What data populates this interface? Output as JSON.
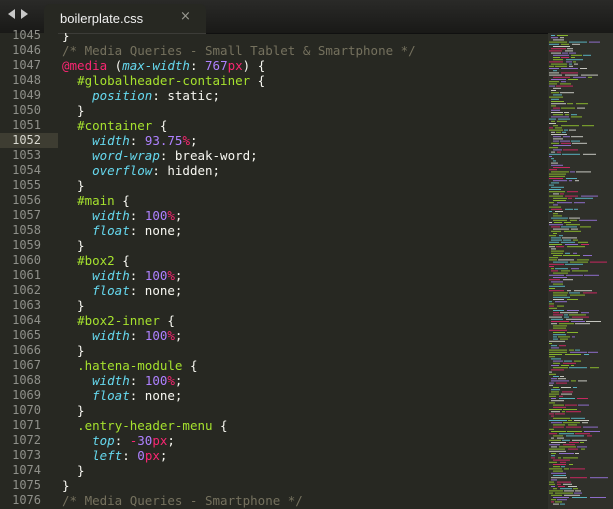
{
  "nav": {
    "back_icon": "chevron-left-icon",
    "forward_icon": "chevron-right-icon"
  },
  "tab": {
    "title": "boilerplate.css",
    "close_glyph": "×"
  },
  "editor": {
    "first_line_partial": "1045",
    "active_line": "1052",
    "lines": [
      {
        "num": "1045",
        "tokens": [
          {
            "t": "}",
            "c": "punct"
          }
        ]
      },
      {
        "num": "1046",
        "tokens": [
          {
            "t": "/* Media Queries - Small Tablet & Smartphone */",
            "c": "comment"
          }
        ]
      },
      {
        "num": "1047",
        "tokens": [
          {
            "t": "@media",
            "c": "at"
          },
          {
            "t": " (",
            "c": "punct"
          },
          {
            "t": "max-width",
            "c": "prop"
          },
          {
            "t": ": ",
            "c": "punct"
          },
          {
            "t": "767",
            "c": "number"
          },
          {
            "t": "px",
            "c": "unit"
          },
          {
            "t": ") {",
            "c": "punct"
          }
        ]
      },
      {
        "num": "1048",
        "tokens": [
          {
            "t": "  ",
            "c": "punct"
          },
          {
            "t": "#globalheader-container",
            "c": "selector"
          },
          {
            "t": " {",
            "c": "punct"
          }
        ]
      },
      {
        "num": "1049",
        "tokens": [
          {
            "t": "    ",
            "c": "punct"
          },
          {
            "t": "position",
            "c": "prop"
          },
          {
            "t": ": static;",
            "c": "value"
          }
        ]
      },
      {
        "num": "1050",
        "tokens": [
          {
            "t": "  }",
            "c": "punct"
          }
        ]
      },
      {
        "num": "1051",
        "tokens": [
          {
            "t": "  ",
            "c": "punct"
          },
          {
            "t": "#container",
            "c": "selector"
          },
          {
            "t": " {",
            "c": "punct"
          }
        ]
      },
      {
        "num": "1052",
        "tokens": [
          {
            "t": "    ",
            "c": "punct"
          },
          {
            "t": "width",
            "c": "prop"
          },
          {
            "t": ": ",
            "c": "punct"
          },
          {
            "t": "93.75",
            "c": "number"
          },
          {
            "t": "%",
            "c": "unit"
          },
          {
            "t": ";",
            "c": "punct"
          }
        ]
      },
      {
        "num": "1053",
        "tokens": [
          {
            "t": "    ",
            "c": "punct"
          },
          {
            "t": "word-wrap",
            "c": "prop"
          },
          {
            "t": ": break-word;",
            "c": "value"
          }
        ]
      },
      {
        "num": "1054",
        "tokens": [
          {
            "t": "    ",
            "c": "punct"
          },
          {
            "t": "overflow",
            "c": "prop"
          },
          {
            "t": ": hidden;",
            "c": "value"
          }
        ]
      },
      {
        "num": "1055",
        "tokens": [
          {
            "t": "  }",
            "c": "punct"
          }
        ]
      },
      {
        "num": "1056",
        "tokens": [
          {
            "t": "  ",
            "c": "punct"
          },
          {
            "t": "#main",
            "c": "selector"
          },
          {
            "t": " {",
            "c": "punct"
          }
        ]
      },
      {
        "num": "1057",
        "tokens": [
          {
            "t": "    ",
            "c": "punct"
          },
          {
            "t": "width",
            "c": "prop"
          },
          {
            "t": ": ",
            "c": "punct"
          },
          {
            "t": "100",
            "c": "number"
          },
          {
            "t": "%",
            "c": "unit"
          },
          {
            "t": ";",
            "c": "punct"
          }
        ]
      },
      {
        "num": "1058",
        "tokens": [
          {
            "t": "    ",
            "c": "punct"
          },
          {
            "t": "float",
            "c": "prop"
          },
          {
            "t": ": none;",
            "c": "value"
          }
        ]
      },
      {
        "num": "1059",
        "tokens": [
          {
            "t": "  }",
            "c": "punct"
          }
        ]
      },
      {
        "num": "1060",
        "tokens": [
          {
            "t": "  ",
            "c": "punct"
          },
          {
            "t": "#box2",
            "c": "selector"
          },
          {
            "t": " {",
            "c": "punct"
          }
        ]
      },
      {
        "num": "1061",
        "tokens": [
          {
            "t": "    ",
            "c": "punct"
          },
          {
            "t": "width",
            "c": "prop"
          },
          {
            "t": ": ",
            "c": "punct"
          },
          {
            "t": "100",
            "c": "number"
          },
          {
            "t": "%",
            "c": "unit"
          },
          {
            "t": ";",
            "c": "punct"
          }
        ]
      },
      {
        "num": "1062",
        "tokens": [
          {
            "t": "    ",
            "c": "punct"
          },
          {
            "t": "float",
            "c": "prop"
          },
          {
            "t": ": none;",
            "c": "value"
          }
        ]
      },
      {
        "num": "1063",
        "tokens": [
          {
            "t": "  }",
            "c": "punct"
          }
        ]
      },
      {
        "num": "1064",
        "tokens": [
          {
            "t": "  ",
            "c": "punct"
          },
          {
            "t": "#box2-inner",
            "c": "selector"
          },
          {
            "t": " {",
            "c": "punct"
          }
        ]
      },
      {
        "num": "1065",
        "tokens": [
          {
            "t": "    ",
            "c": "punct"
          },
          {
            "t": "width",
            "c": "prop"
          },
          {
            "t": ": ",
            "c": "punct"
          },
          {
            "t": "100",
            "c": "number"
          },
          {
            "t": "%",
            "c": "unit"
          },
          {
            "t": ";",
            "c": "punct"
          }
        ]
      },
      {
        "num": "1066",
        "tokens": [
          {
            "t": "  }",
            "c": "punct"
          }
        ]
      },
      {
        "num": "1067",
        "tokens": [
          {
            "t": "  ",
            "c": "punct"
          },
          {
            "t": ".hatena-module",
            "c": "selector"
          },
          {
            "t": " {",
            "c": "punct"
          }
        ]
      },
      {
        "num": "1068",
        "tokens": [
          {
            "t": "    ",
            "c": "punct"
          },
          {
            "t": "width",
            "c": "prop"
          },
          {
            "t": ": ",
            "c": "punct"
          },
          {
            "t": "100",
            "c": "number"
          },
          {
            "t": "%",
            "c": "unit"
          },
          {
            "t": ";",
            "c": "punct"
          }
        ]
      },
      {
        "num": "1069",
        "tokens": [
          {
            "t": "    ",
            "c": "punct"
          },
          {
            "t": "float",
            "c": "prop"
          },
          {
            "t": ": none;",
            "c": "value"
          }
        ]
      },
      {
        "num": "1070",
        "tokens": [
          {
            "t": "  }",
            "c": "punct"
          }
        ]
      },
      {
        "num": "1071",
        "tokens": [
          {
            "t": "  ",
            "c": "punct"
          },
          {
            "t": ".entry-header-menu",
            "c": "selector"
          },
          {
            "t": " {",
            "c": "punct"
          }
        ]
      },
      {
        "num": "1072",
        "tokens": [
          {
            "t": "    ",
            "c": "punct"
          },
          {
            "t": "top",
            "c": "prop"
          },
          {
            "t": ": ",
            "c": "punct"
          },
          {
            "t": "-",
            "c": "op"
          },
          {
            "t": "30",
            "c": "number"
          },
          {
            "t": "px",
            "c": "unit"
          },
          {
            "t": ";",
            "c": "punct"
          }
        ]
      },
      {
        "num": "1073",
        "tokens": [
          {
            "t": "    ",
            "c": "punct"
          },
          {
            "t": "left",
            "c": "prop"
          },
          {
            "t": ": ",
            "c": "punct"
          },
          {
            "t": "0",
            "c": "number"
          },
          {
            "t": "px",
            "c": "unit"
          },
          {
            "t": ";",
            "c": "punct"
          }
        ]
      },
      {
        "num": "1074",
        "tokens": [
          {
            "t": "  }",
            "c": "punct"
          }
        ]
      },
      {
        "num": "1075",
        "tokens": [
          {
            "t": "}",
            "c": "punct"
          }
        ]
      },
      {
        "num": "1076",
        "tokens": [
          {
            "t": "/* Media Queries - Smartphone */",
            "c": "comment"
          }
        ]
      }
    ]
  },
  "colors": {
    "background": "#272822",
    "comment": "#75715e",
    "keyword": "#f92672",
    "selector": "#a6e22e",
    "property": "#66d9ef",
    "number": "#ae81ff",
    "text": "#f8f8f2"
  }
}
